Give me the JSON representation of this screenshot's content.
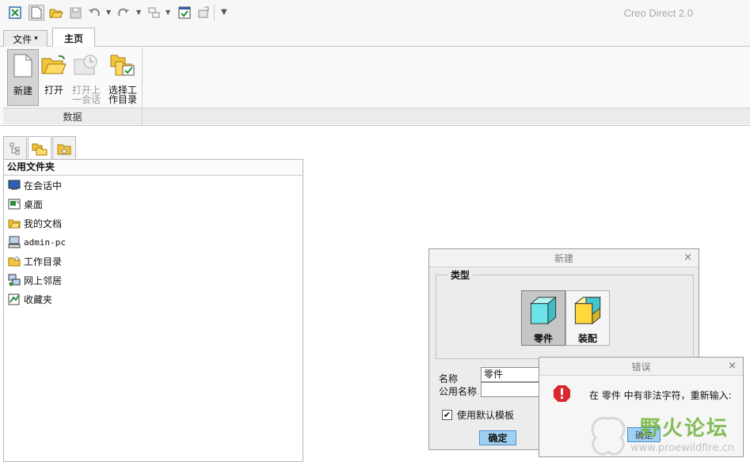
{
  "app": {
    "title": "Creo Direct 2.0"
  },
  "ribbon": {
    "tabs": [
      {
        "label": "文件",
        "arrow": "▾"
      },
      {
        "label": "主页"
      }
    ],
    "buttons": [
      {
        "label": "新建",
        "icon": "new-file-icon"
      },
      {
        "label": "打开",
        "icon": "open-folder-icon"
      },
      {
        "label_1": "打开上",
        "label_2": "一会话",
        "icon": "open-last-session-icon"
      },
      {
        "label_1": "选择工",
        "label_2": "作目录",
        "icon": "select-working-directory-icon"
      }
    ],
    "group_label": "数据"
  },
  "navigator": {
    "header": "公用文件夹",
    "items": [
      {
        "label": "在会话中",
        "icon": "in-session-icon"
      },
      {
        "label": "桌面",
        "icon": "desktop-icon"
      },
      {
        "label": "我的文档",
        "icon": "my-documents-icon"
      },
      {
        "label": "admin-pc",
        "icon": "computer-icon"
      },
      {
        "label": "工作目录",
        "icon": "working-directory-icon"
      },
      {
        "label": "网上邻居",
        "icon": "network-icon"
      },
      {
        "label": "收藏夹",
        "icon": "favorites-icon"
      }
    ]
  },
  "new_dialog": {
    "title": "新建",
    "close": "×",
    "type_label": "类型",
    "types": [
      {
        "label": "零件",
        "selected": true
      },
      {
        "label": "装配",
        "selected": false
      }
    ],
    "name_label": "名称",
    "name_value": "零件",
    "common_name_label": "公用名称",
    "common_name_value": "",
    "use_default_template_label": "使用默认模板",
    "use_default_template_checked": true,
    "check_mark": "✔",
    "ok_label": "确定"
  },
  "error_dialog": {
    "title": "错误",
    "close": "×",
    "message": "在 零件 中有非法字符，重新输入:",
    "ok_label": "确定"
  },
  "watermark": {
    "text": "野火论坛",
    "url": "www.proewildfire.cn"
  },
  "colors": {
    "accent_button": "#9fd0f3",
    "error_icon": "#d9272e",
    "watermark_green": "#70b339"
  }
}
